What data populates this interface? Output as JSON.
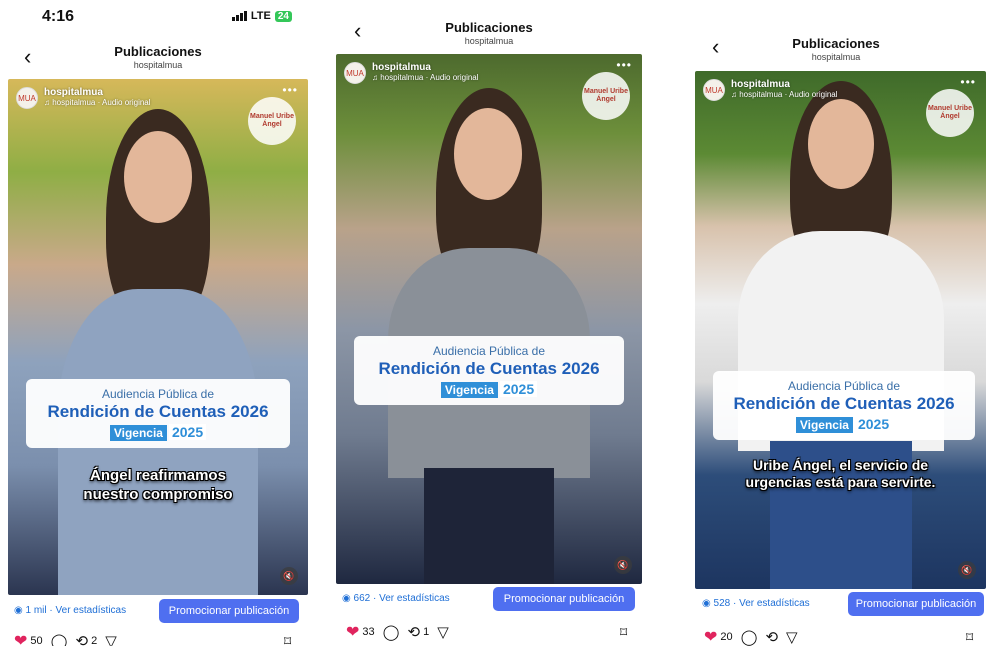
{
  "status": {
    "time": "4:16",
    "network": "LTE",
    "battery": "24"
  },
  "panels": [
    {
      "title": "Publicaciones",
      "subtitle": "hospitalmua",
      "username": "hospitalmua",
      "audio": "hospitalmua · Audio original",
      "card": {
        "top": "Audiencia Pública de",
        "main": "Rendición de Cuentas 2026",
        "vigencia": "Vigencia",
        "year": "2025"
      },
      "caption": "Ángel reafirmamos nuestro compromiso",
      "views": "1 mil · Ver estadísticas",
      "promo": "Promocionar publicación",
      "likes": "50",
      "reposts": "2"
    },
    {
      "title": "Publicaciones",
      "subtitle": "hospitalmua",
      "username": "hospitalmua",
      "audio": "hospitalmua · Audio original",
      "card": {
        "top": "Audiencia Pública de",
        "main": "Rendición de Cuentas 2026",
        "vigencia": "Vigencia",
        "year": "2025"
      },
      "views": "662 · Ver estadísticas",
      "promo": "Promocionar publicación",
      "likes": "33",
      "reposts": "1"
    },
    {
      "title": "Publicaciones",
      "subtitle": "hospitalmua",
      "username": "hospitalmua",
      "audio": "hospitalmua · Audio original",
      "card": {
        "top": "Audiencia Pública de",
        "main": "Rendición de Cuentas 2026",
        "vigencia": "Vigencia",
        "year": "2025"
      },
      "caption": "Uribe Ángel, el servicio de urgencias está para servirte.",
      "views": "528 · Ver estadísticas",
      "promo": "Promocionar publicación",
      "likes": "20"
    }
  ],
  "logo_text": "Manuel Uribe Ángel",
  "colors": {
    "accent": "#4f6ff0",
    "like": "#e0245e",
    "link": "#1f6fd6",
    "title_blue": "#1f5fb8"
  },
  "icons": [
    "back-icon",
    "more-icon",
    "music-icon",
    "heart-icon",
    "comment-icon",
    "repost-icon",
    "share-icon",
    "bookmark-icon",
    "mute-icon",
    "eye-icon"
  ]
}
